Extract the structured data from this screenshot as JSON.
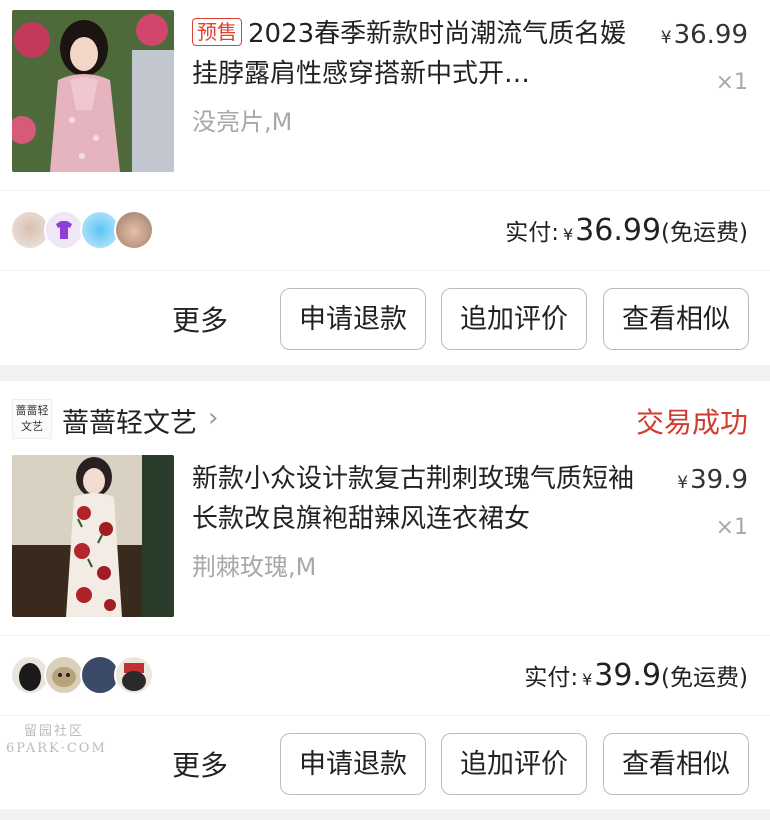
{
  "orders": [
    {
      "product": {
        "tag": "预售",
        "title": "2023春季新款时尚潮流气质名媛挂脖露肩性感穿搭新中式开…",
        "sku": "没亮片,M",
        "price_currency": "¥",
        "price": "36.99",
        "quantity": "×1",
        "thumb_icon": "pink-qipao-photo"
      },
      "payment": {
        "label": "实付:",
        "currency": "¥",
        "amount": "36.99",
        "note": "(免运费)"
      },
      "actions": {
        "more": "更多",
        "refund": "申请退款",
        "review": "追加评价",
        "similar": "查看相似"
      }
    },
    {
      "shop": {
        "logo_text_line1": "蔷蔷轻",
        "logo_text_line2": "文艺",
        "name": "蔷蔷轻文艺",
        "chevron": "›",
        "status": "交易成功"
      },
      "product": {
        "tag": "",
        "title": "新款小众设计款复古荆刺玫瑰气质短袖长款改良旗袍甜辣风连衣裙女",
        "sku": "荆棘玫瑰,M",
        "price_currency": "¥",
        "price": "39.9",
        "quantity": "×1",
        "thumb_icon": "rose-qipao-photo"
      },
      "payment": {
        "label": "实付:",
        "currency": "¥",
        "amount": "39.9",
        "note": "(免运费)"
      },
      "actions": {
        "more": "更多",
        "refund": "申请退款",
        "review": "追加评价",
        "similar": "查看相似"
      }
    }
  ],
  "watermark": {
    "line1": "留园社区",
    "line2": "6PARK·COM"
  },
  "colors": {
    "accent_red": "#cf3d2e",
    "muted_gray": "#a8a8a8",
    "page_bg": "#f2f2f2"
  }
}
